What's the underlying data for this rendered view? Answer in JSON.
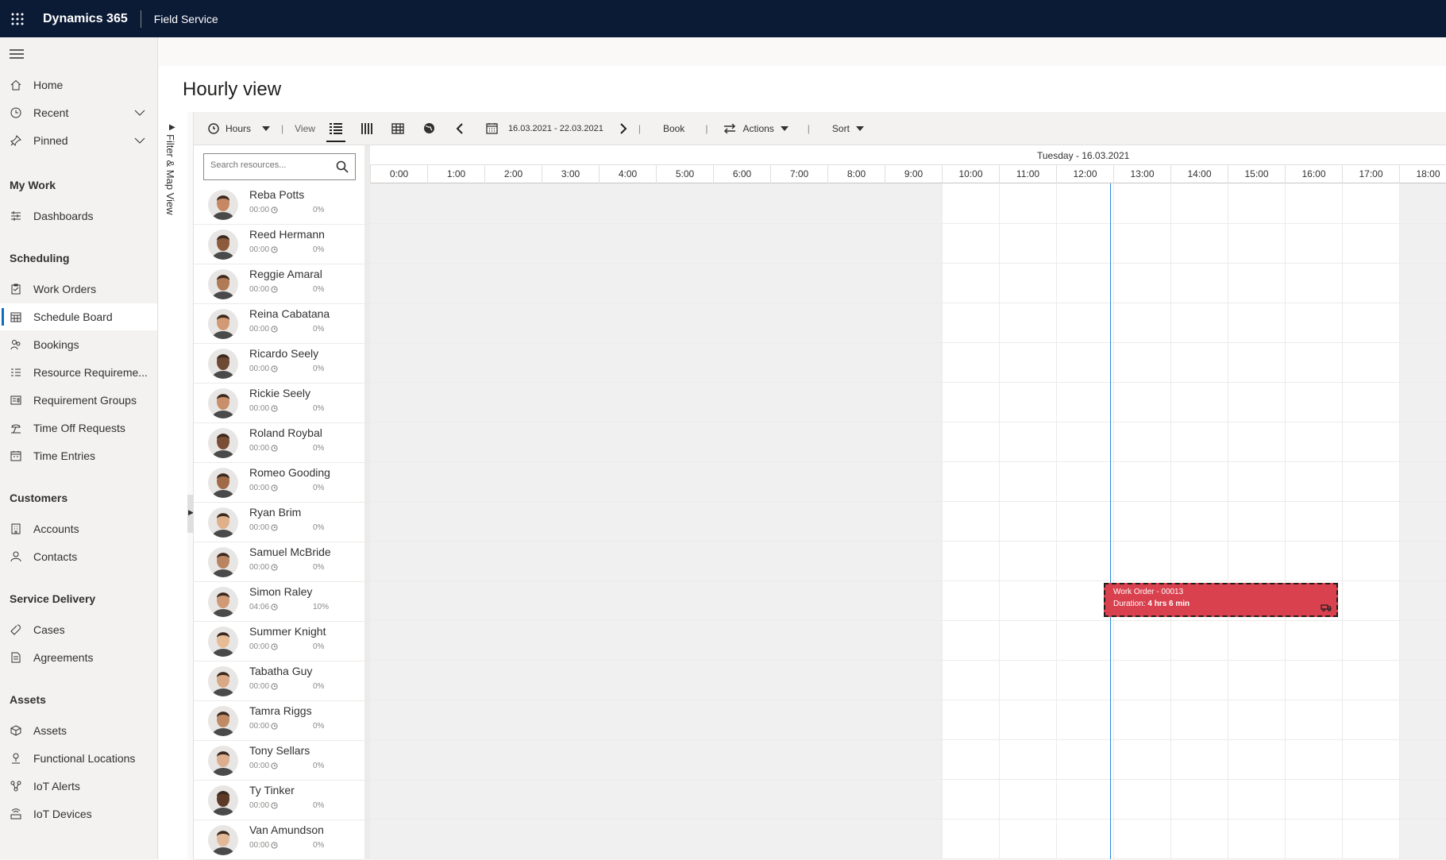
{
  "topbar": {
    "brand": "Dynamics 365",
    "app": "Field Service"
  },
  "nav": {
    "home": "Home",
    "recent": "Recent",
    "pinned": "Pinned",
    "sections": {
      "my_work": "My Work",
      "scheduling": "Scheduling",
      "customers": "Customers",
      "service_delivery": "Service Delivery",
      "assets": "Assets"
    },
    "items": {
      "dashboards": "Dashboards",
      "work_orders": "Work Orders",
      "schedule_board": "Schedule Board",
      "bookings": "Bookings",
      "resource_requirements": "Resource Requireme...",
      "requirement_groups": "Requirement Groups",
      "time_off_requests": "Time Off Requests",
      "time_entries": "Time Entries",
      "accounts": "Accounts",
      "contacts": "Contacts",
      "cases": "Cases",
      "agreements": "Agreements",
      "assets": "Assets",
      "functional_locations": "Functional Locations",
      "iot_alerts": "IoT Alerts",
      "iot_devices": "IoT Devices"
    },
    "selected": "schedule_board"
  },
  "page": {
    "title": "Hourly view",
    "filter_label": "Filter & Map View"
  },
  "toolbar": {
    "timescale": "Hours",
    "view_label": "View",
    "date_range": "16.03.2021 - 22.03.2021",
    "book": "Book",
    "actions": "Actions",
    "sort": "Sort",
    "separator": "|"
  },
  "search": {
    "placeholder": "Search resources..."
  },
  "schedule": {
    "day_label": "Tuesday - 16.03.2021",
    "hours": [
      "0:00",
      "1:00",
      "2:00",
      "3:00",
      "4:00",
      "5:00",
      "6:00",
      "7:00",
      "8:00",
      "9:00",
      "10:00",
      "11:00",
      "12:00",
      "13:00",
      "14:00",
      "15:00",
      "16:00",
      "17:00",
      "18:00"
    ],
    "working_hours": [
      10,
      18
    ],
    "now_hour": 12.95
  },
  "resources": [
    {
      "name": "Reba Potts",
      "hours": "00:00",
      "pct": "0%"
    },
    {
      "name": "Reed Hermann",
      "hours": "00:00",
      "pct": "0%"
    },
    {
      "name": "Reggie Amaral",
      "hours": "00:00",
      "pct": "0%"
    },
    {
      "name": "Reina Cabatana",
      "hours": "00:00",
      "pct": "0%"
    },
    {
      "name": "Ricardo Seely",
      "hours": "00:00",
      "pct": "0%"
    },
    {
      "name": "Rickie Seely",
      "hours": "00:00",
      "pct": "0%"
    },
    {
      "name": "Roland Roybal",
      "hours": "00:00",
      "pct": "0%"
    },
    {
      "name": "Romeo Gooding",
      "hours": "00:00",
      "pct": "0%"
    },
    {
      "name": "Ryan Brim",
      "hours": "00:00",
      "pct": "0%"
    },
    {
      "name": "Samuel McBride",
      "hours": "00:00",
      "pct": "0%"
    },
    {
      "name": "Simon Raley",
      "hours": "04:06",
      "pct": "10%"
    },
    {
      "name": "Summer Knight",
      "hours": "00:00",
      "pct": "0%"
    },
    {
      "name": "Tabatha Guy",
      "hours": "00:00",
      "pct": "0%"
    },
    {
      "name": "Tamra Riggs",
      "hours": "00:00",
      "pct": "0%"
    },
    {
      "name": "Tony Sellars",
      "hours": "00:00",
      "pct": "0%"
    },
    {
      "name": "Ty Tinker",
      "hours": "00:00",
      "pct": "0%"
    },
    {
      "name": "Van Amundson",
      "hours": "00:00",
      "pct": "0%"
    }
  ],
  "booking": {
    "title": "Work Order - 00013",
    "duration_label": "Duration:",
    "duration_value": "4 hrs 6 min",
    "resource_index": 10,
    "start_hour": 12.83,
    "end_hour": 16.93,
    "color": "#d9414e"
  },
  "colors": {
    "topbar": "#0b1a35",
    "accent": "#0f6cbd",
    "now_line": "#2b88d8"
  }
}
